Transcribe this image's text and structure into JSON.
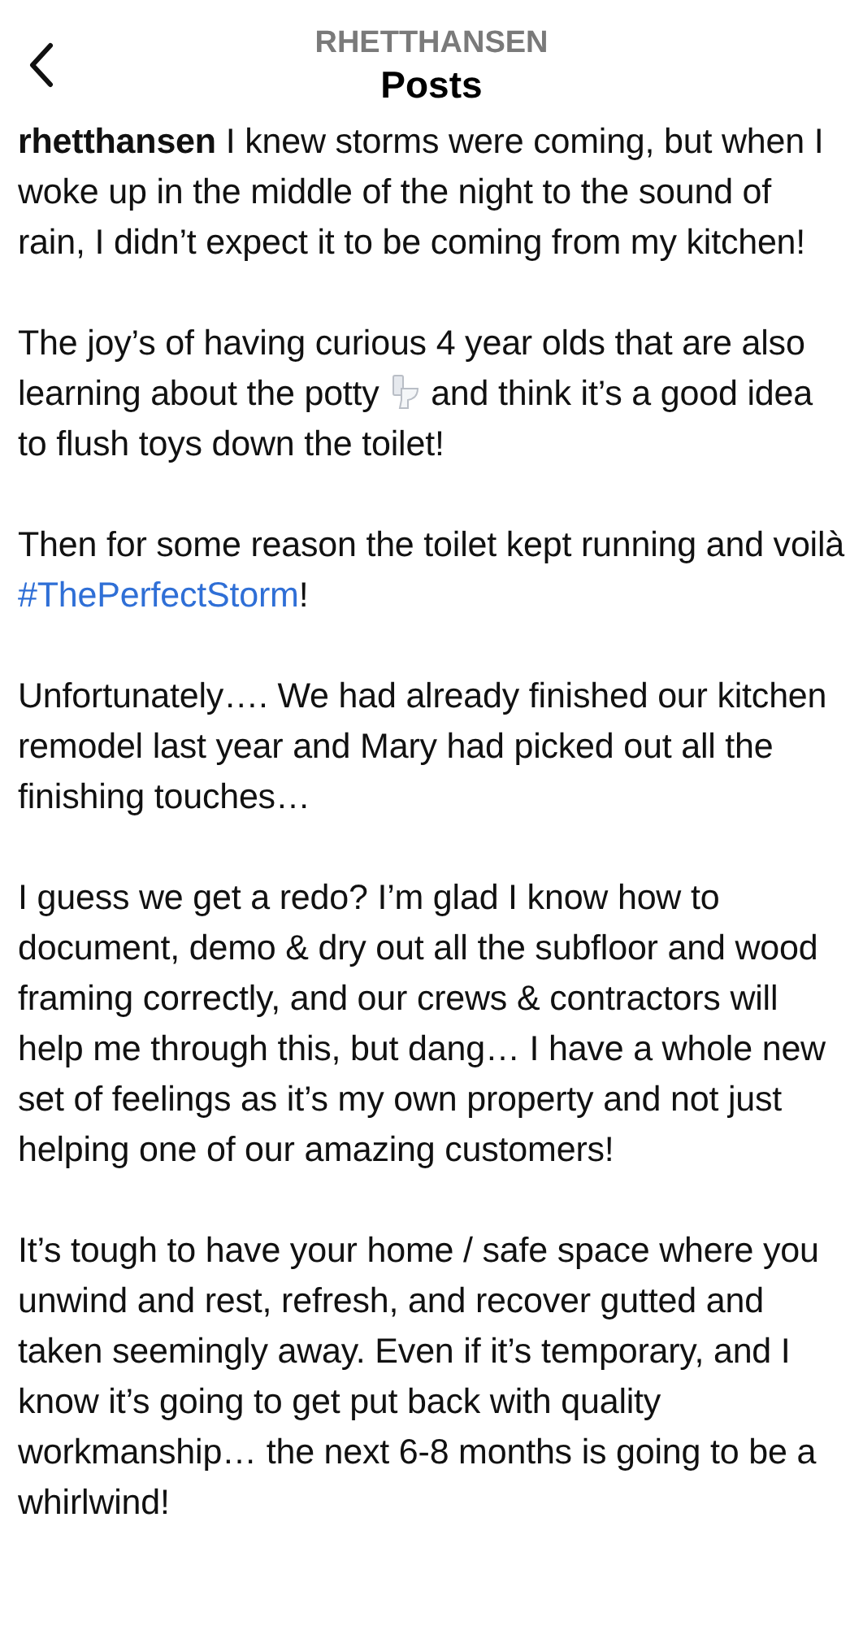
{
  "header": {
    "account": "RHETTHANSEN",
    "title": "Posts"
  },
  "paragraphs": [
    {
      "segments": [
        {
          "kind": "bold",
          "text": "rhetthansen"
        },
        {
          "kind": "text",
          "text": " I knew storms were coming, but when I woke up in the middle of the night to the sound of rain, I didn’t expect it to be coming from my kitchen!"
        }
      ]
    },
    {
      "segments": [
        {
          "kind": "text",
          "text": "The joy’s of having curious 4 year olds that are also learning about the potty "
        },
        {
          "kind": "toilet"
        },
        {
          "kind": "text",
          "text": " and think it’s a good idea to flush toys down the toilet!"
        }
      ]
    },
    {
      "segments": [
        {
          "kind": "text",
          "text": "Then for some reason the toilet kept running and voilà "
        },
        {
          "kind": "link",
          "text": "#ThePerfectStorm"
        },
        {
          "kind": "text",
          "text": "!"
        }
      ]
    },
    {
      "segments": [
        {
          "kind": "text",
          "text": "Unfortunately…. We had already finished our kitchen remodel last year and Mary had picked out all the finishing touches…"
        }
      ]
    },
    {
      "segments": [
        {
          "kind": "text",
          "text": "I guess we get a redo? I’m glad I know how to document, demo & dry out all the subfloor and wood framing correctly, and our crews & contractors will help me through this, but dang… I have a whole new set of feelings as it’s my own property and not just helping one of our amazing customers!"
        }
      ]
    },
    {
      "segments": [
        {
          "kind": "text",
          "text": "It’s tough to have your home / safe space where you unwind and rest, refresh, and recover gutted and taken seemingly away. Even if it’s temporary, and I know it’s going to get put back with quality workmanship… the next 6-8 months is going to be a whirlwind!"
        }
      ]
    }
  ]
}
